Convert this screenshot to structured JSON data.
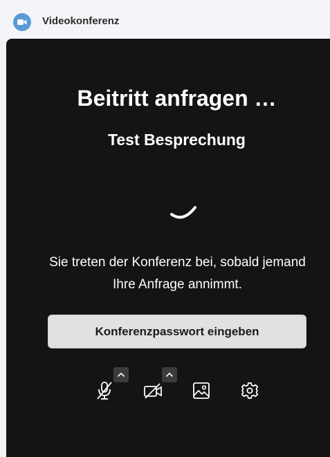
{
  "window": {
    "title": "Videokonferenz",
    "icon": "video-camera-icon"
  },
  "main": {
    "title": "Beitritt anfragen …",
    "meeting_name": "Test Besprechung",
    "message": "Sie treten der Konferenz bei, sobald jemand Ihre Anfrage annimmt.",
    "password_button_label": "Konferenzpasswort eingeben"
  },
  "toolbar": {
    "items": [
      {
        "name": "microphone-muted-icon",
        "has_options": true
      },
      {
        "name": "camera-off-icon",
        "has_options": true
      },
      {
        "name": "background-image-icon",
        "has_options": false
      },
      {
        "name": "settings-gear-icon",
        "has_options": false
      }
    ]
  },
  "colors": {
    "panel_background": "#141414",
    "header_background": "#f3f5f8",
    "accent": "#5b9bd5",
    "button_background": "#e1e1e1"
  }
}
